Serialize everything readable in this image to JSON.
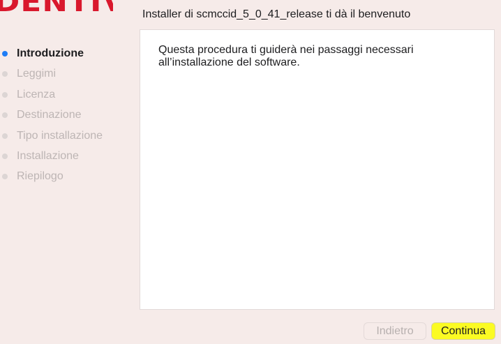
{
  "logo": {
    "text": "DENTIV",
    "color": "#d9182d"
  },
  "header": {
    "title": "Installer di scmccid_5_0_41_release ti dà il benvenuto"
  },
  "sidebar": {
    "steps": [
      {
        "label": "Introduzione",
        "active": true
      },
      {
        "label": "Leggimi",
        "active": false
      },
      {
        "label": "Licenza",
        "active": false
      },
      {
        "label": "Destinazione",
        "active": false
      },
      {
        "label": "Tipo installazione",
        "active": false
      },
      {
        "label": "Installazione",
        "active": false
      },
      {
        "label": "Riepilogo",
        "active": false
      }
    ],
    "active_dot_color": "#1f7df6"
  },
  "content": {
    "message": "Questa procedura ti guiderà nei passaggi necessari all’installazione del software."
  },
  "buttons": {
    "back_label": "Indietro",
    "back_enabled": false,
    "continue_label": "Continua",
    "continue_highlight_color": "#fbfb23"
  }
}
